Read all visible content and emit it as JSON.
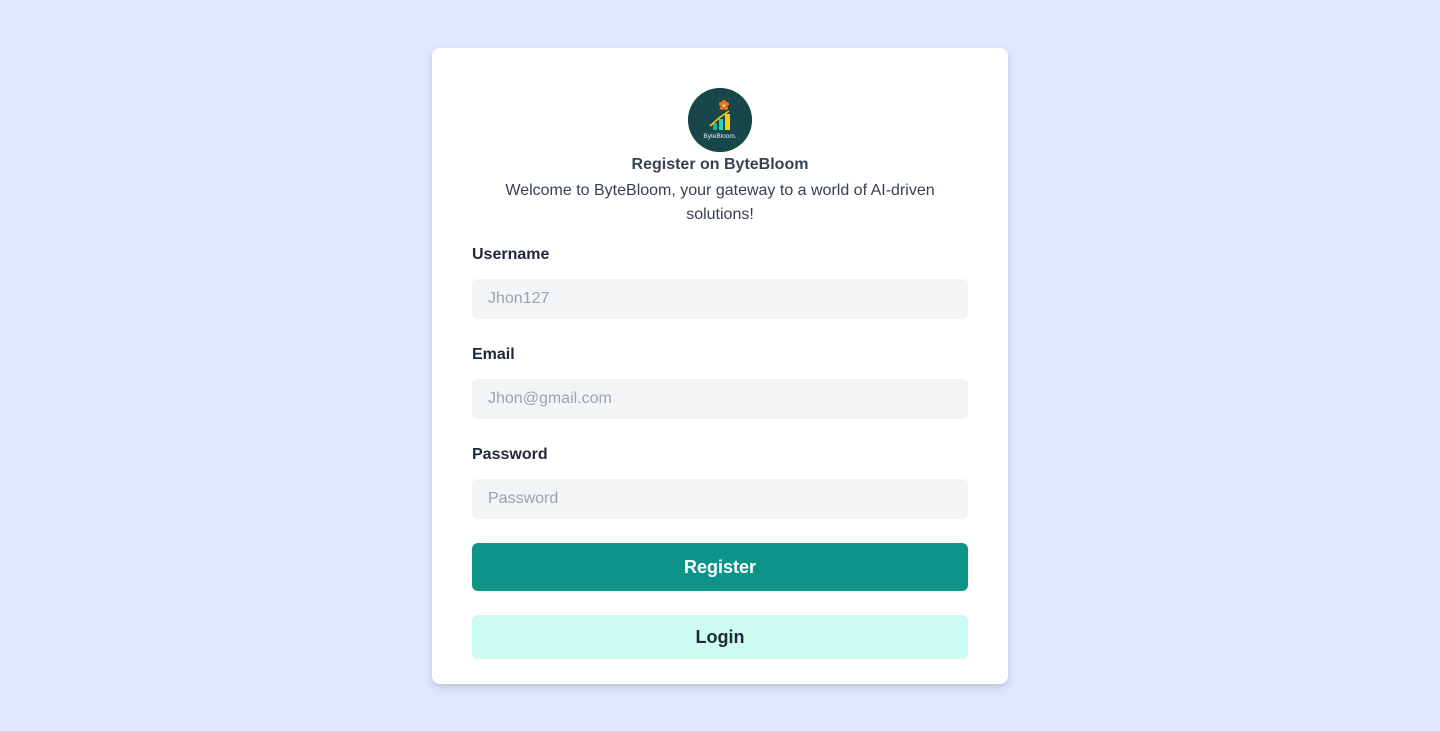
{
  "brand": {
    "logo_icon": "byte-bloom-logo",
    "logo_text": "ByteBloom.",
    "colors": {
      "logo_bg": "#17474a",
      "page_bg": "#e0e7ff",
      "primary": "#0d9488",
      "secondary": "#ccfbf1"
    }
  },
  "header": {
    "title": "Register on ByteBloom",
    "subtitle": "Welcome to ByteBloom, your gateway to a world of AI-driven solutions!"
  },
  "form": {
    "username": {
      "label": "Username",
      "placeholder": "Jhon127",
      "value": ""
    },
    "email": {
      "label": "Email",
      "placeholder": "Jhon@gmail.com",
      "value": ""
    },
    "password": {
      "label": "Password",
      "placeholder": "Password",
      "value": ""
    }
  },
  "actions": {
    "register_label": "Register",
    "login_label": "Login"
  }
}
